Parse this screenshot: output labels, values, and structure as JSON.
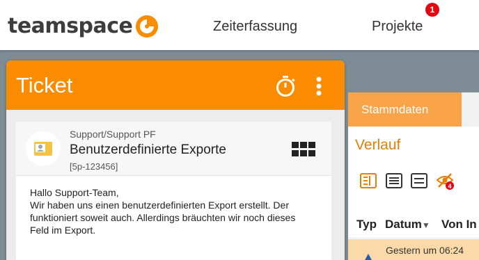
{
  "app": {
    "logo_text": "teamspace",
    "brand_color": "#fb8c00",
    "nav": [
      {
        "label": "Zeiterfassung"
      },
      {
        "label": "Projekte",
        "badge": "1"
      }
    ]
  },
  "ticket": {
    "title": "Ticket",
    "timer_icon": "stopwatch-icon",
    "more_icon": "more-vertical-icon",
    "category": "Support/Support PF",
    "subject": "Benutzerdefinierte Exporte",
    "id": "[5p-123456]",
    "message_lines": [
      "Hallo Support-Team,",
      "Wir haben uns einen benutzerdefinierten Export erstellt. Der",
      "funktioniert soweit auch. Allerdings bräuchten wir noch dieses",
      "Feld im Export."
    ]
  },
  "right_panel": {
    "tabs": [
      {
        "label": "Stammdaten"
      }
    ],
    "section_title": "Verlauf",
    "toolbar_icons": [
      "list-detail-icon",
      "list-icon",
      "list-compact-icon",
      "hidden-eye-icon"
    ],
    "hidden_badge": "4",
    "columns": [
      {
        "label": "Typ"
      },
      {
        "label": "Datum"
      },
      {
        "label": "Von In"
      }
    ],
    "rows": [
      {
        "date": "Gestern um 06:24"
      }
    ]
  }
}
